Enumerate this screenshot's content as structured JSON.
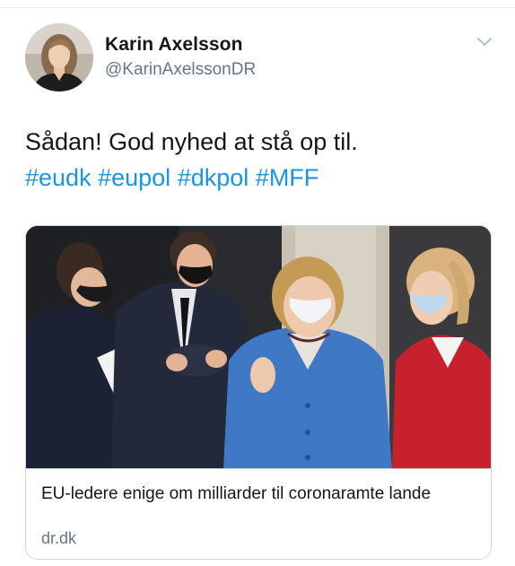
{
  "tweet": {
    "author": {
      "name": "Karin Axelsson",
      "handle": "@KarinAxelssonDR",
      "avatar_icon": "profile-photo"
    },
    "menu_icon": "chevron-down-icon",
    "text": "Sådan! God nyhed at stå op til.",
    "hashtags": [
      "#eudk",
      "#eupol",
      "#dkpol",
      "#MFF"
    ],
    "link_color": "#1b95e0",
    "card": {
      "image_icon": "news-photo",
      "title": "EU-ledere enige om milliarder til coronaramte lande",
      "domain": "dr.dk"
    }
  }
}
